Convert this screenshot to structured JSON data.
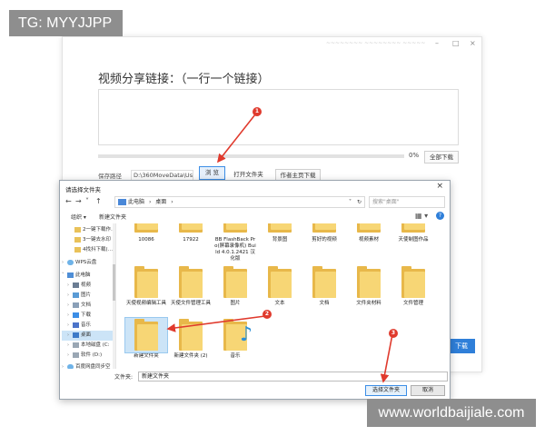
{
  "watermark_top": "TG: MYYJJPP",
  "watermark_bottom": "www.worldbaijiale.com",
  "app": {
    "title_text": "~~~~~~~~ ~~~~~~~~ ~~~~~",
    "minimize": "–",
    "maximize": "□",
    "close": "×",
    "heading": "视频分享链接：（一行一个链接）",
    "progress_percent": 0,
    "progress_text": "0%",
    "download_all": "全部下载",
    "save_path_label": "保存路径",
    "save_path_value": "D:\\360MoveData\\Users\\",
    "browse": "浏 览",
    "open_folder": "打开文件夹",
    "author_home_download": "作者主页下载",
    "right_button": "下载"
  },
  "dialog": {
    "title": "请选择文件夹",
    "close": "×",
    "nav_back": "←",
    "nav_forward": "→",
    "nav_dropdown": "˅",
    "nav_up": "↑",
    "address_path": [
      "此电脑",
      "›",
      "桌面",
      "›"
    ],
    "address_dropdown": "˅",
    "refresh": "↻",
    "search_placeholder": "搜索\"桌面\"",
    "organize": "组织 ▾",
    "new_folder": "新建文件夹",
    "view_icon": "▦ ▾",
    "help": "?",
    "tree": [
      {
        "label": "2一键下载作…",
        "icon": "folder"
      },
      {
        "label": "3一键去水印",
        "icon": "folder"
      },
      {
        "label": "4找抖下载(…",
        "icon": "folder"
      },
      {
        "label": "WPS云盘",
        "icon": "cloud"
      },
      {
        "label": "此电脑",
        "icon": "pc"
      },
      {
        "label": "视频",
        "icon": "video"
      },
      {
        "label": "图片",
        "icon": "pic"
      },
      {
        "label": "文档",
        "icon": "doc"
      },
      {
        "label": "下载",
        "icon": "down"
      },
      {
        "label": "音乐",
        "icon": "music"
      },
      {
        "label": "桌面",
        "icon": "desk"
      },
      {
        "label": "本地磁盘 (C:",
        "icon": "drive"
      },
      {
        "label": "软件 (D:)",
        "icon": "drive"
      },
      {
        "label": "百度网盘同步空",
        "icon": "cloud"
      }
    ],
    "row1": [
      {
        "label": "10086"
      },
      {
        "label": "17922"
      },
      {
        "label": "BB FlashBack Pro(屏幕录像机) Build 4.0.1.2421 汉化版"
      },
      {
        "label": "背景图"
      },
      {
        "label": "剪好的视频"
      },
      {
        "label": "视频素材"
      },
      {
        "label": "天使制图作品"
      }
    ],
    "row2": [
      {
        "label": "天使视频编辑工具"
      },
      {
        "label": "天使文件管理工具"
      },
      {
        "label": "图片"
      },
      {
        "label": "文本"
      },
      {
        "label": "文档"
      },
      {
        "label": "文件夹材料"
      },
      {
        "label": "文件管理"
      }
    ],
    "row3": [
      {
        "label": "新建文件夹",
        "selected": true
      },
      {
        "label": "新建文件夹 (2)"
      },
      {
        "label": "音乐",
        "music": true
      }
    ],
    "folder_label": "文件夹:",
    "folder_value": "新建文件夹",
    "select_folder": "选择文件夹",
    "cancel": "取消"
  },
  "annotations": {
    "badge1": "1",
    "badge2": "2",
    "badge3": "3",
    "arrow_color": "#e03a2d"
  }
}
